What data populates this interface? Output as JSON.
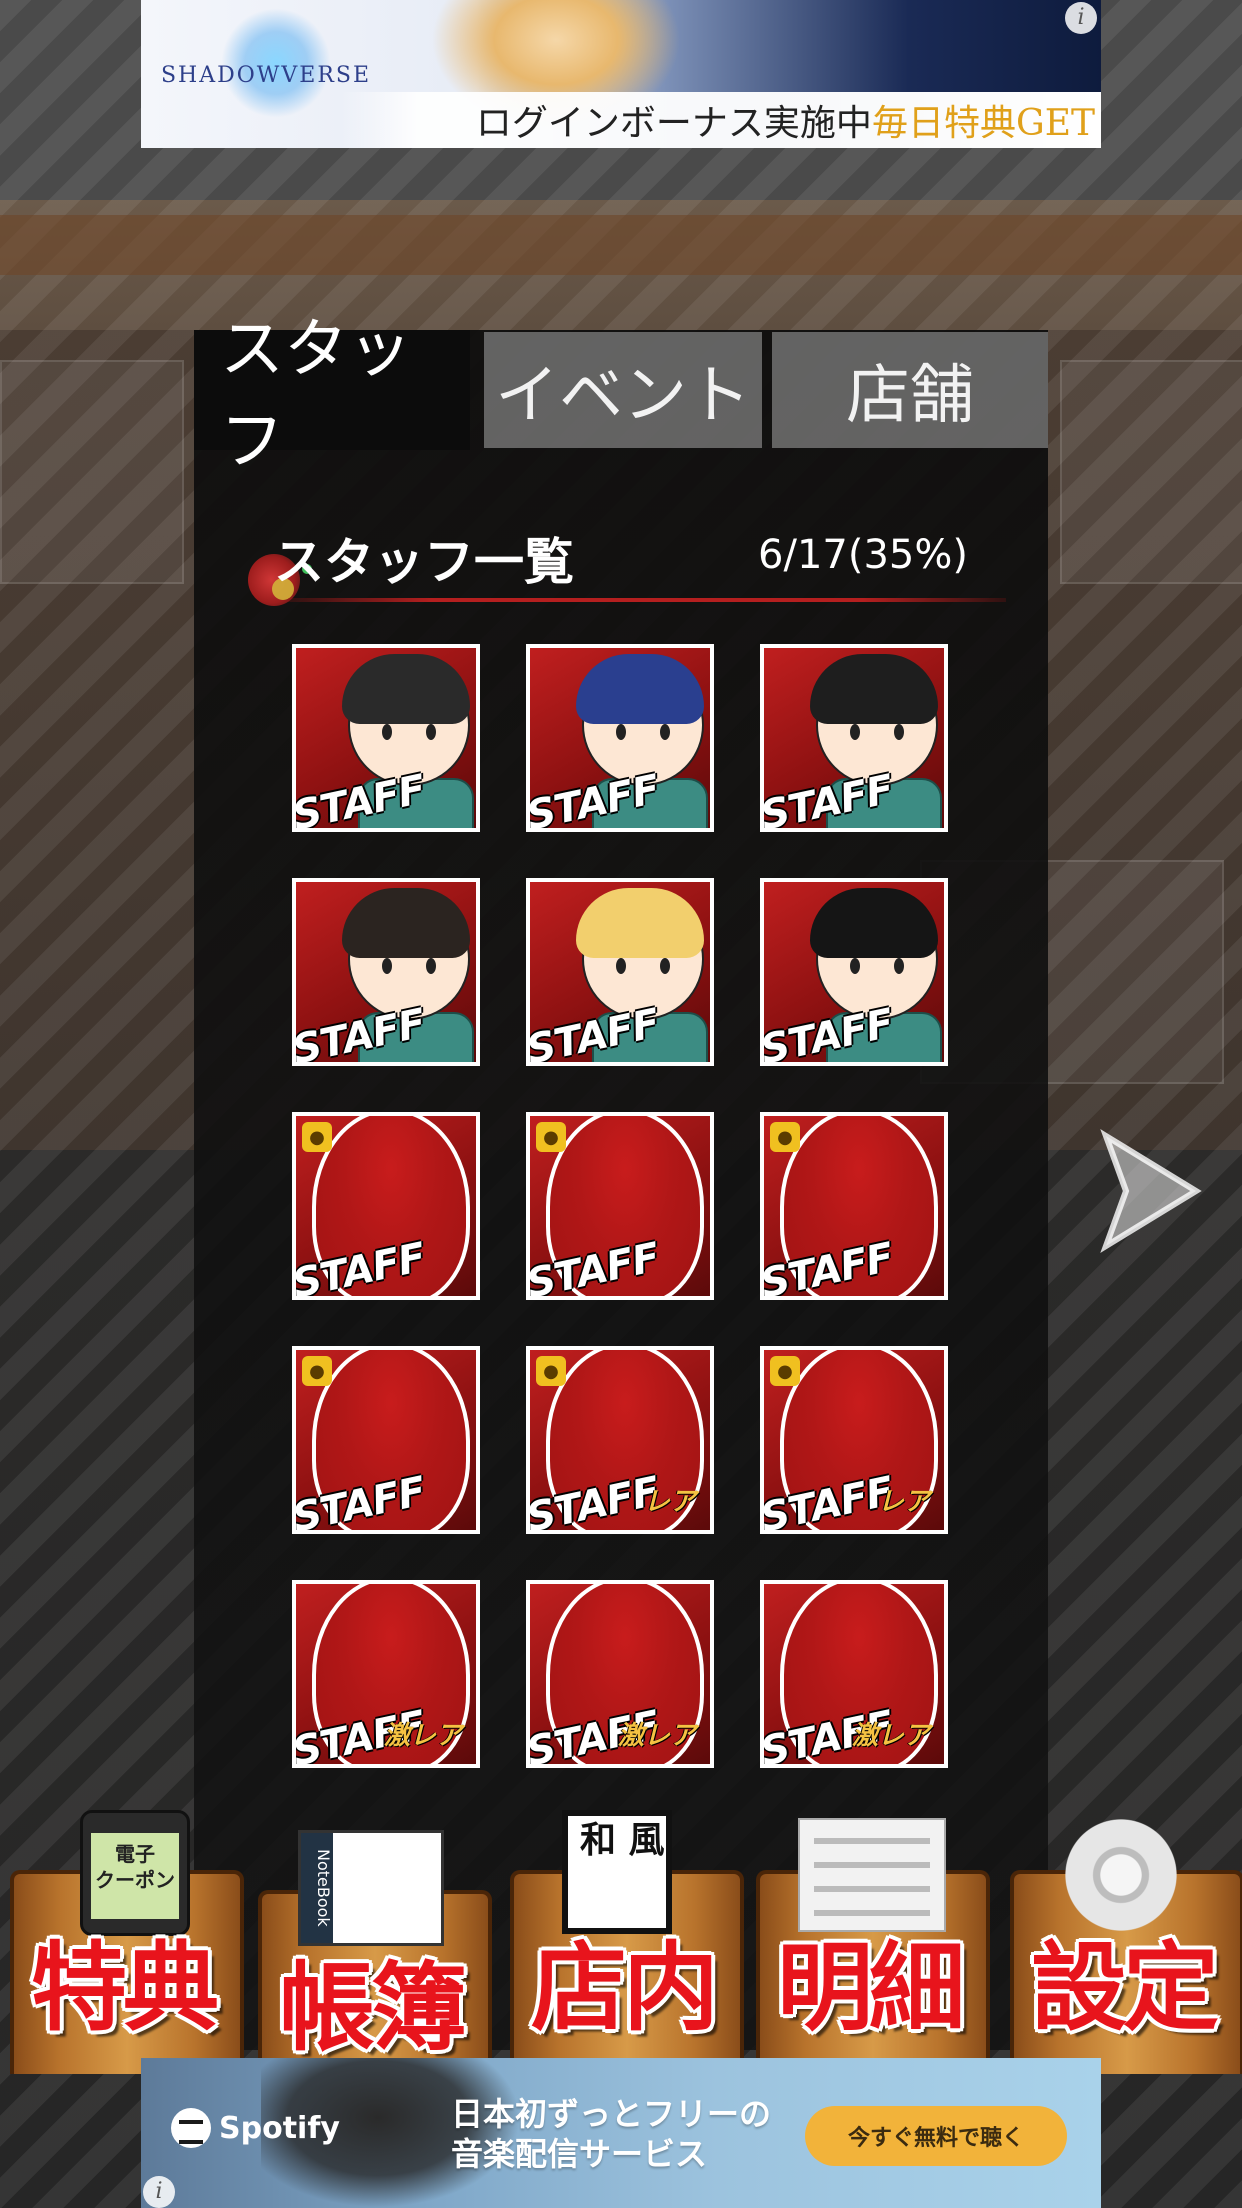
{
  "ads": {
    "top": {
      "brand": "SHADOWVERSE",
      "text_main": "ログインボーナス実施中",
      "text_highlight": "毎日特典GET",
      "info": "i"
    },
    "bottom": {
      "brand": "Spotify",
      "copy_line1": "日本初ずっとフリーの",
      "copy_line2": "音楽配信サービス",
      "cta": "今すぐ無料で聴く",
      "info": "i"
    }
  },
  "tabs": [
    {
      "label": "スタッフ",
      "active": true
    },
    {
      "label": "イベント",
      "active": false
    },
    {
      "label": "店舗",
      "active": false
    }
  ],
  "staff_list": {
    "title": "スタッフ一覧",
    "progress_text": "6/17(35%)",
    "progress_fraction": 0.35,
    "card_text": "STAFF",
    "cards": [
      {
        "status": "unlocked",
        "hair": "#2a2a2a",
        "skin": "#fde7d4",
        "rarity": ""
      },
      {
        "status": "unlocked",
        "hair": "#2a3f8f",
        "skin": "#fde7d4",
        "rarity": ""
      },
      {
        "status": "unlocked",
        "hair": "#1e1e1e",
        "skin": "#fde7d4",
        "rarity": ""
      },
      {
        "status": "unlocked",
        "hair": "#2b2420",
        "skin": "#fde7d4",
        "rarity": ""
      },
      {
        "status": "unlocked",
        "hair": "#f2cf6d",
        "skin": "#fde7d4",
        "rarity": ""
      },
      {
        "status": "unlocked",
        "hair": "#151515",
        "skin": "#fde7d4",
        "rarity": ""
      },
      {
        "status": "locked",
        "rarity": ""
      },
      {
        "status": "locked",
        "rarity": ""
      },
      {
        "status": "locked",
        "rarity": ""
      },
      {
        "status": "locked",
        "rarity": ""
      },
      {
        "status": "locked",
        "rarity": "レア"
      },
      {
        "status": "locked",
        "rarity": "レア"
      },
      {
        "status": "locked-hidden",
        "rarity": "激レア"
      },
      {
        "status": "locked-hidden",
        "rarity": "激レア"
      },
      {
        "status": "locked-hidden",
        "rarity": "激レア"
      }
    ]
  },
  "nav": [
    {
      "label": "特典",
      "icon": "phone-coupon-icon",
      "icon_text": "電子\nクーポン"
    },
    {
      "label": "帳簿",
      "icon": "notebook-icon",
      "icon_text": "NoteBook"
    },
    {
      "label": "店内",
      "icon": "wafu-sign-icon",
      "icon_text": "和 風"
    },
    {
      "label": "明細",
      "icon": "document-icon",
      "icon_text": ""
    },
    {
      "label": "設定",
      "icon": "gear-icon",
      "icon_text": ""
    }
  ],
  "colors": {
    "accent_red": "#e8141c",
    "card_red": "#b51f1f",
    "panel_dark": "#0c0c0c",
    "cta_yellow": "#f2b33a"
  }
}
